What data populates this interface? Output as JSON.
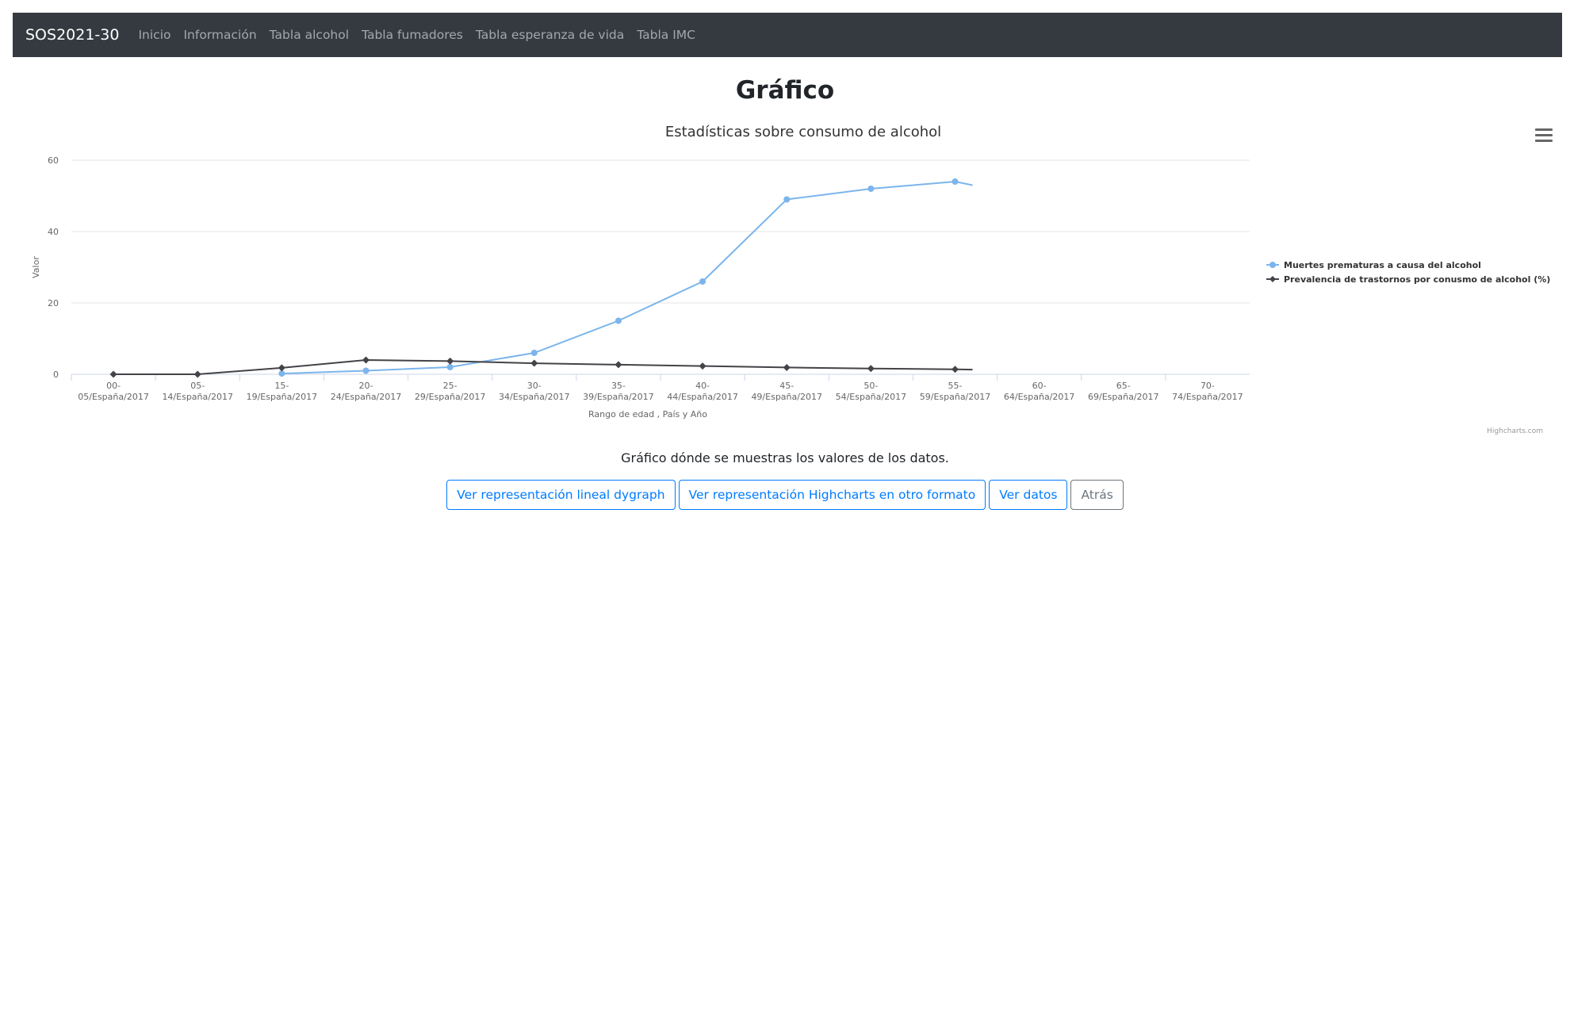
{
  "navbar": {
    "brand": "SOS2021-30",
    "links": [
      "Inicio",
      "Información",
      "Tabla alcohol",
      "Tabla fumadores",
      "Tabla esperanza de vida",
      "Tabla IMC"
    ]
  },
  "page": {
    "title": "Gráfico",
    "caption": "Gráfico dónde se muestras los valores de los datos."
  },
  "buttons": {
    "dygraph": "Ver representación lineal dygraph",
    "highcharts_other": "Ver representación Highcharts en otro formato",
    "view_data": "Ver datos",
    "back": "Atrás"
  },
  "chart_data": {
    "type": "line",
    "title": "Estadísticas sobre consumo de alcohol",
    "xlabel": "Rango de edad , País y Año",
    "ylabel": "Valor",
    "credits": "Highcharts.com",
    "ylim": [
      0,
      60
    ],
    "yticks": [
      0,
      20,
      40,
      60
    ],
    "grid": true,
    "legend_position": "right",
    "categories": [
      [
        "00-",
        "05/España/2017"
      ],
      [
        "05-",
        "14/España/2017"
      ],
      [
        "15-",
        "19/España/2017"
      ],
      [
        "20-",
        "24/España/2017"
      ],
      [
        "25-",
        "29/España/2017"
      ],
      [
        "30-",
        "34/España/2017"
      ],
      [
        "35-",
        "39/España/2017"
      ],
      [
        "40-",
        "44/España/2017"
      ],
      [
        "45-",
        "49/España/2017"
      ],
      [
        "50-",
        "54/España/2017"
      ],
      [
        "55-",
        "59/España/2017"
      ],
      [
        "60-",
        "64/España/2017"
      ],
      [
        "65-",
        "69/España/2017"
      ],
      [
        "70-",
        "74/España/2017"
      ]
    ],
    "series": [
      {
        "name": "Muertes prematuras a causa del alcohol",
        "color": "#7cb5ec",
        "marker": "circle",
        "values": [
          null,
          null,
          0.2,
          1,
          2,
          6,
          15,
          26,
          49,
          52,
          54
        ],
        "tail_value": 53
      },
      {
        "name": "Prevalencia de trastornos por conusmo de alcohol (%)",
        "color": "#434348",
        "marker": "diamond",
        "values": [
          0,
          0,
          1.8,
          4,
          3.7,
          3.1,
          2.7,
          2.3,
          1.9,
          1.6,
          1.4
        ],
        "tail_value": 1.3
      }
    ]
  }
}
